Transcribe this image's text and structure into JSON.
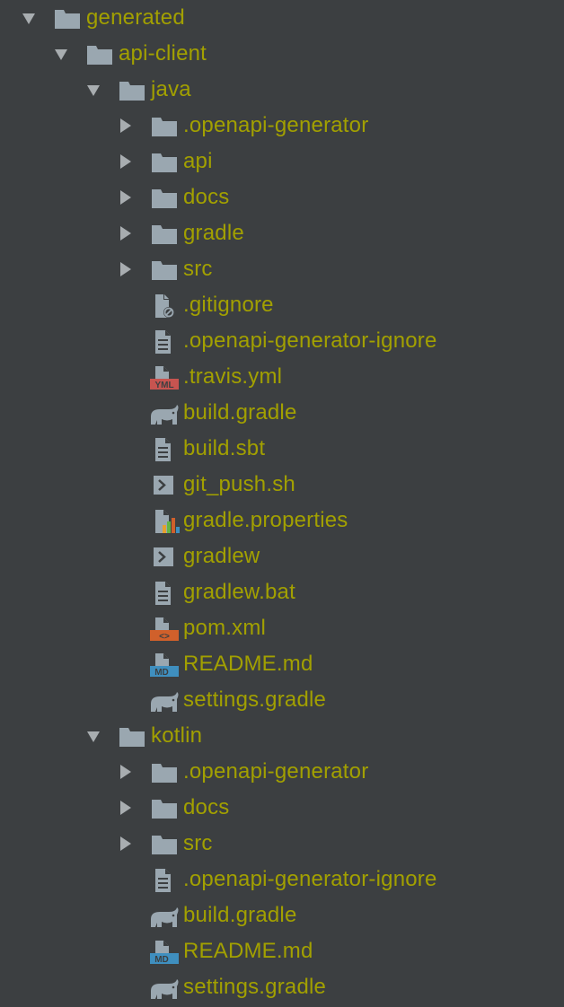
{
  "tree": {
    "generated": "generated",
    "api_client": "api-client",
    "java": {
      "label": "java",
      "folders": [
        ".openapi-generator",
        "api",
        "docs",
        "gradle",
        "src"
      ],
      "files": [
        {
          "name": ".gitignore",
          "icon": "gitignore-file-icon"
        },
        {
          "name": ".openapi-generator-ignore",
          "icon": "text-file-icon"
        },
        {
          "name": ".travis.yml",
          "icon": "yaml-file-icon",
          "badge": "YML"
        },
        {
          "name": "build.gradle",
          "icon": "gradle-elephant-icon"
        },
        {
          "name": "build.sbt",
          "icon": "text-file-icon"
        },
        {
          "name": "git_push.sh",
          "icon": "shell-script-icon"
        },
        {
          "name": "gradle.properties",
          "icon": "properties-file-icon"
        },
        {
          "name": "gradlew",
          "icon": "shell-script-icon"
        },
        {
          "name": "gradlew.bat",
          "icon": "text-file-icon"
        },
        {
          "name": "pom.xml",
          "icon": "xml-file-icon",
          "badge": "<>"
        },
        {
          "name": "README.md",
          "icon": "markdown-file-icon",
          "badge": "MD"
        },
        {
          "name": "settings.gradle",
          "icon": "gradle-elephant-icon"
        }
      ]
    },
    "kotlin": {
      "label": "kotlin",
      "folders": [
        ".openapi-generator",
        "docs",
        "src"
      ],
      "files": [
        {
          "name": ".openapi-generator-ignore",
          "icon": "text-file-icon"
        },
        {
          "name": "build.gradle",
          "icon": "gradle-elephant-icon"
        },
        {
          "name": "README.md",
          "icon": "markdown-file-icon",
          "badge": "MD"
        },
        {
          "name": "settings.gradle",
          "icon": "gradle-elephant-icon"
        }
      ]
    }
  },
  "colors": {
    "background": "#3c3f41",
    "label": "#a2a000",
    "icon_gray": "#9aa7b0",
    "yml_badge": "#c75450",
    "xml_badge": "#d0602b",
    "md_badge": "#3f8fbf"
  }
}
